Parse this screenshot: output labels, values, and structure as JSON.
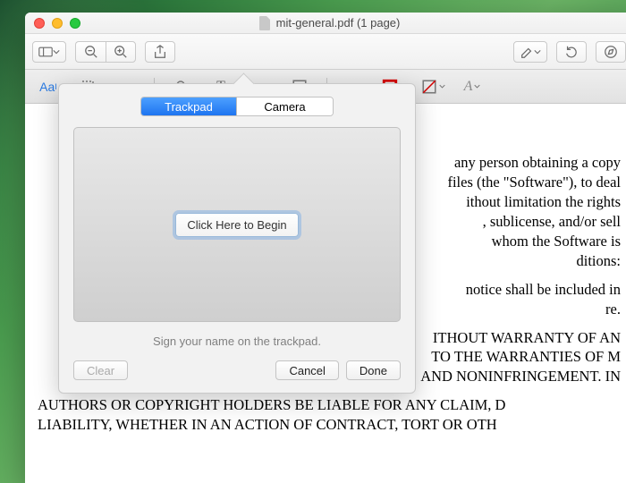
{
  "window": {
    "title": "mit-general.pdf (1 page)"
  },
  "signature_popover": {
    "tabs": {
      "trackpad": "Trackpad",
      "camera": "Camera"
    },
    "begin_button": "Click Here to Begin",
    "hint": "Sign your name on the trackpad.",
    "buttons": {
      "clear": "Clear",
      "cancel": "Cancel",
      "done": "Done"
    }
  },
  "markup_toolbar": {
    "text_style_label": "Aa",
    "text_tool_label": "T",
    "font_tool_label": "A"
  },
  "document": {
    "p1": " any person obtaining a copy\n files (the \"Software\"), to deal\nithout limitation the rights\n, sublicense, and/or sell\n whom the Software is\nditions:",
    "p2": " notice shall be included in\nre.",
    "p3": "ITHOUT WARRANTY OF AN\n TO THE WARRANTIES OF M\nAND NONINFRINGEMENT. IN",
    "p4": "AUTHORS OR COPYRIGHT HOLDERS BE LIABLE FOR ANY CLAIM, D\nLIABILITY, WHETHER IN AN ACTION OF CONTRACT, TORT OR OTH"
  }
}
